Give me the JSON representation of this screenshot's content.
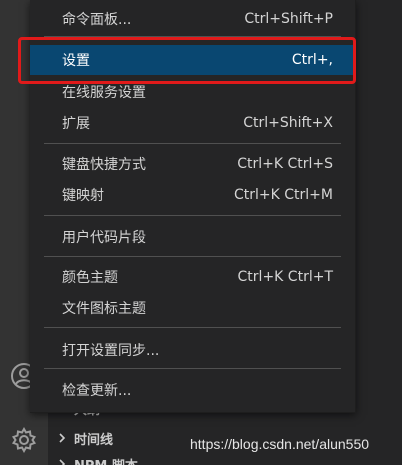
{
  "menu": {
    "items": [
      {
        "label": "命令面板...",
        "shortcut": "Ctrl+Shift+P"
      },
      {
        "label": "设置",
        "shortcut": "Ctrl+,"
      },
      {
        "label": "在线服务设置",
        "shortcut": ""
      },
      {
        "label": "扩展",
        "shortcut": "Ctrl+Shift+X"
      },
      {
        "label": "键盘快捷方式",
        "shortcut": "Ctrl+K Ctrl+S"
      },
      {
        "label": "键映射",
        "shortcut": "Ctrl+K Ctrl+M"
      },
      {
        "label": "用户代码片段",
        "shortcut": ""
      },
      {
        "label": "颜色主题",
        "shortcut": "Ctrl+K Ctrl+T"
      },
      {
        "label": "文件图标主题",
        "shortcut": ""
      },
      {
        "label": "打开设置同步...",
        "shortcut": ""
      },
      {
        "label": "检查更新...",
        "shortcut": ""
      }
    ],
    "active_item": "设置"
  },
  "side_panel": {
    "sections": [
      {
        "label": "大纲"
      },
      {
        "label": "时间线"
      },
      {
        "label": "NPM 脚本"
      }
    ]
  },
  "watermark": "https://blog.csdn.net/alun550",
  "icons": {
    "account": "account-icon",
    "settings": "gear-icon",
    "chevron": "chevron-right-icon"
  },
  "colors": {
    "active_item_bg": "#094771",
    "highlight_border": "#e11a1a",
    "menu_bg": "#252526"
  }
}
